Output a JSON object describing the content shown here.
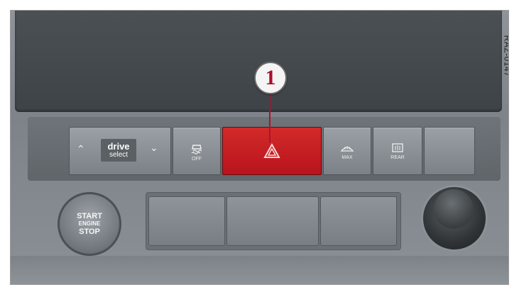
{
  "figure": {
    "reference_code": "RAZ-0147",
    "callout_number": "1"
  },
  "button_row": {
    "drive_select": {
      "label_top": "drive",
      "label_bottom": "select"
    },
    "traction_off": {
      "label": "OFF",
      "icon": "esc-off-icon"
    },
    "hazard": {
      "icon": "hazard-triangle-icon",
      "color": "#c81e24"
    },
    "front_defrost": {
      "label": "MAX",
      "icon": "front-defrost-icon"
    },
    "rear_defrost": {
      "label": "REAR",
      "icon": "rear-defrost-icon"
    }
  },
  "start_button": {
    "line1": "START",
    "line2": "ENGINE",
    "line3": "STOP"
  },
  "colors": {
    "callout": "#a8102a",
    "panel": "#7d8389",
    "screen": "#44494d"
  }
}
